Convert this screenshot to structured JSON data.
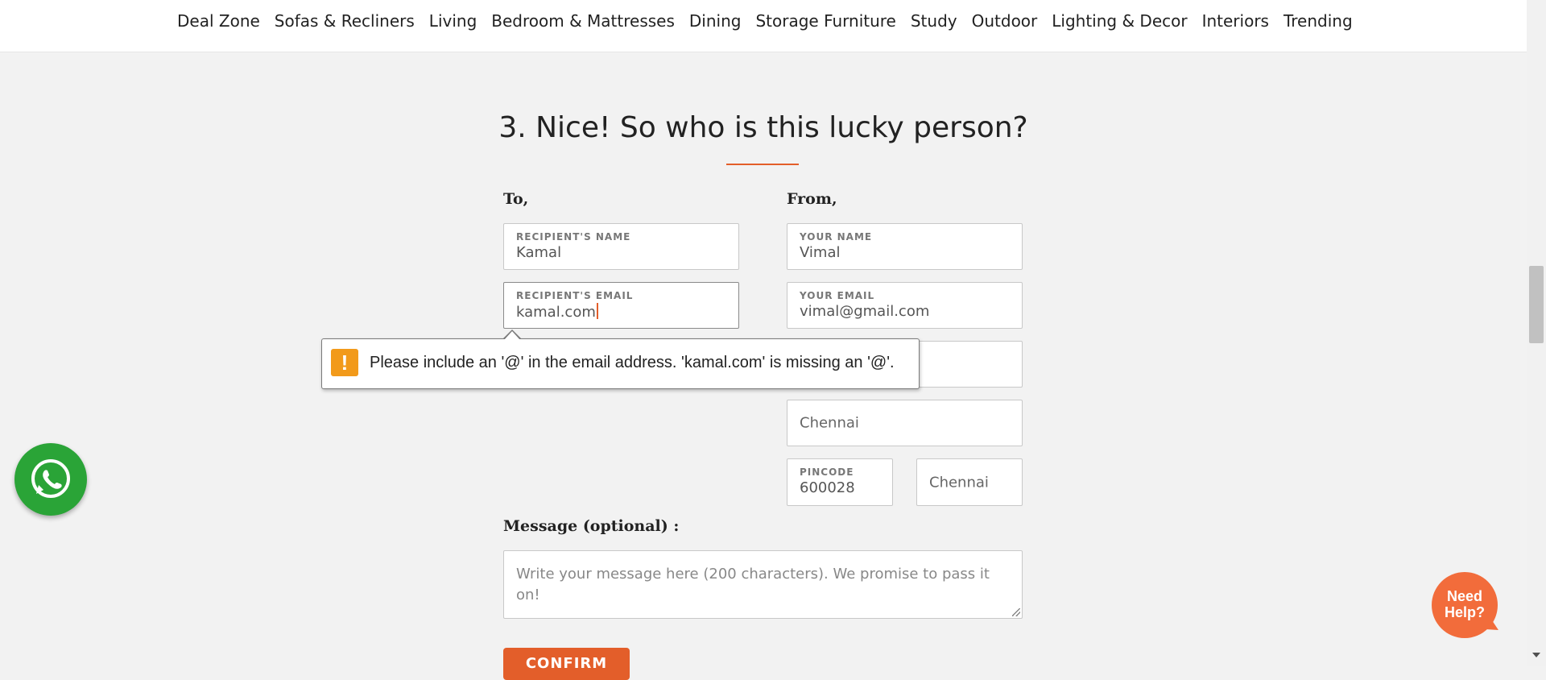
{
  "nav": {
    "items": [
      "Deal Zone",
      "Sofas & Recliners",
      "Living",
      "Bedroom & Mattresses",
      "Dining",
      "Storage Furniture",
      "Study",
      "Outdoor",
      "Lighting & Decor",
      "Interiors",
      "Trending"
    ]
  },
  "section": {
    "heading": "3. Nice! So who is this lucky person?",
    "to_label": "To,",
    "from_label": "From,"
  },
  "to": {
    "name_label": "RECIPIENT'S NAME",
    "name_value": "Kamal",
    "email_label": "RECIPIENT'S EMAIL",
    "email_value": "kamal.com"
  },
  "from": {
    "name_label": "YOUR NAME",
    "name_value": "Vimal",
    "email_label": "YOUR EMAIL",
    "email_value": "vimal@gmail.com",
    "city_value": "Chennai",
    "pincode_label": "PINCODE",
    "pincode_value": "600028",
    "state_value": "Chennai"
  },
  "validation": {
    "icon": "!",
    "message": "Please include an '@' in the email address. 'kamal.com' is missing an '@'."
  },
  "message": {
    "label": "Message (optional) :",
    "placeholder": "Write your message here (200 characters). We promise to pass it on!"
  },
  "confirm": {
    "label": "CONFIRM"
  },
  "help": {
    "label_line1": "Need",
    "label_line2": "Help?"
  },
  "colors": {
    "accent": "#e35e2a",
    "whatsapp": "#2aa437",
    "warning": "#f29a1a"
  }
}
